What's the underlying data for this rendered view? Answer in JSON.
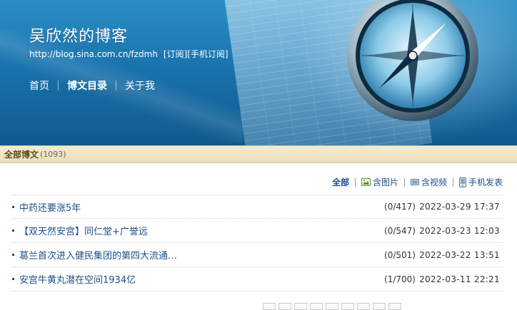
{
  "blog": {
    "title": "吴欣然的博客",
    "url": "http://blog.sina.com.cn/fzdmh",
    "subscribe": "[订阅]",
    "mobile_subscribe": "[手机订阅]"
  },
  "nav": {
    "home": "首页",
    "catalog": "博文目录",
    "about": "关于我"
  },
  "section": {
    "label": "全部博文",
    "count": "(1093)"
  },
  "filters": {
    "all": "全部",
    "with_images": "含图片",
    "with_video": "含视频",
    "mobile_post": "手机发表"
  },
  "posts": [
    {
      "title": "中药还要涨5年",
      "stats": "(0/417)",
      "date": "2022-03-29 17:37"
    },
    {
      "title": "【双天然安宫】同仁堂+广誉远",
      "stats": "(0/547)",
      "date": "2022-03-23 12:03"
    },
    {
      "title": "葛兰首次进入健民集团的第四大流通…",
      "stats": "(0/501)",
      "date": "2022-03-22 13:51"
    },
    {
      "title": "安宫牛黄丸潜在空间1934亿",
      "stats": "(1/700)",
      "date": "2022-03-11 22:21"
    }
  ],
  "colors": {
    "link": "#1b4f8a",
    "banner": "#1a73ad",
    "section_bar": "#ebdfbb"
  }
}
